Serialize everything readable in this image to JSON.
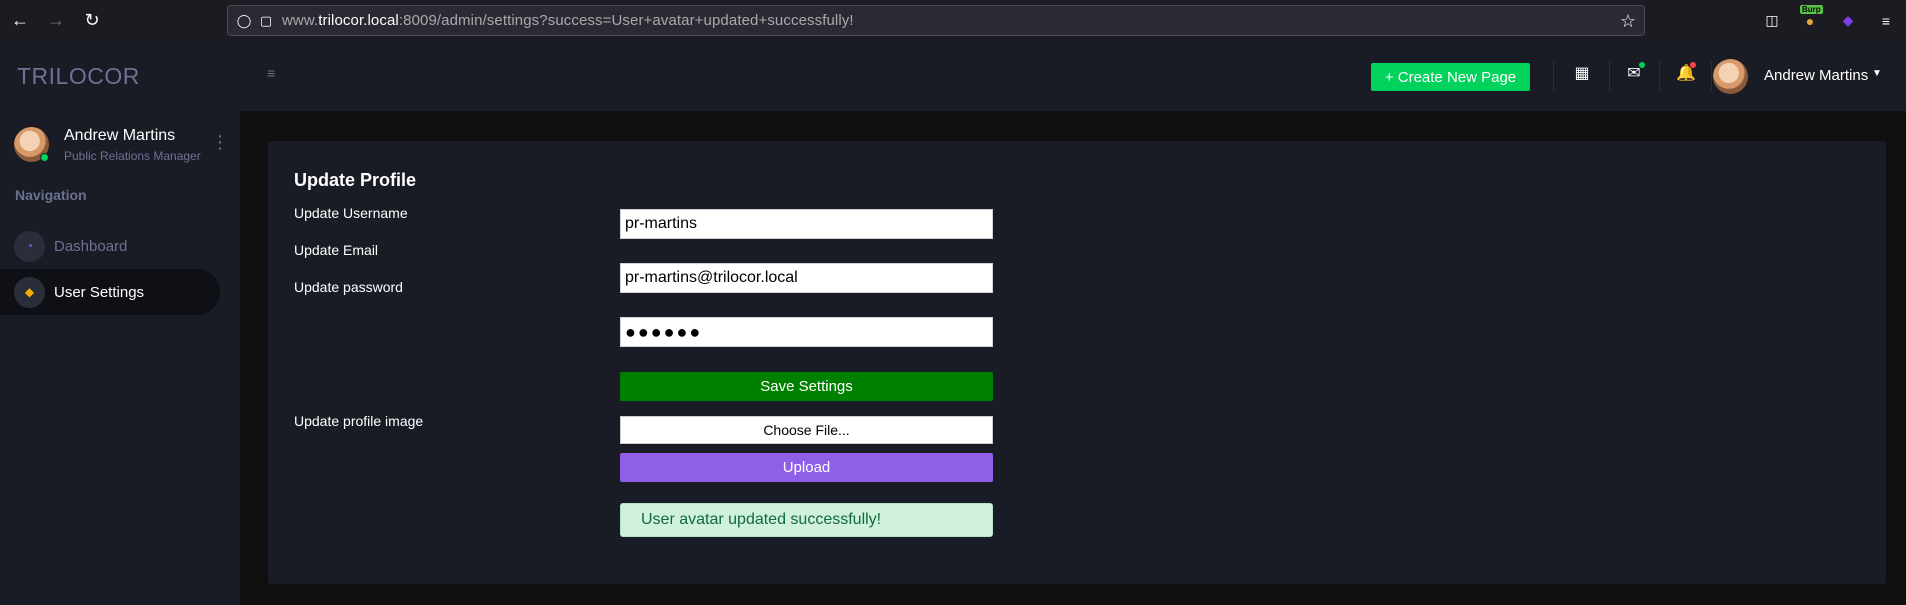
{
  "browser": {
    "url_prefix": "www.",
    "url_host": "trilocor.local",
    "url_rest": ":8009/admin/settings?success=User+avatar+updated+successfully!",
    "burp_badge": "Burp"
  },
  "sidebar": {
    "brand": "TRILOCOR",
    "profile_name": "Andrew Martins",
    "profile_role": "Public Relations Manager",
    "nav_category": "Navigation",
    "items": [
      {
        "label": "Dashboard",
        "icon": "speedometer-icon",
        "active": false
      },
      {
        "label": "User Settings",
        "icon": "shield-icon",
        "active": true
      }
    ]
  },
  "navbar": {
    "create_button": "+ Create New Page",
    "user_name": "Andrew Martins"
  },
  "profile_form": {
    "title": "Update Profile",
    "username_label": "Update Username",
    "username_value": "pr-martins",
    "email_label": "Update Email",
    "email_value": "pr-martins@trilocor.local",
    "password_label": "Update password",
    "password_value": "●●●●●●",
    "save_button": "Save Settings",
    "image_label": "Update profile image",
    "file_button": "Choose File...",
    "upload_button": "Upload",
    "success_message": "User avatar updated successfully!"
  },
  "colors": {
    "success": "#00d25b",
    "save": "#008000",
    "upload": "#8f5fe8",
    "alert_bg": "#d1f1df"
  }
}
